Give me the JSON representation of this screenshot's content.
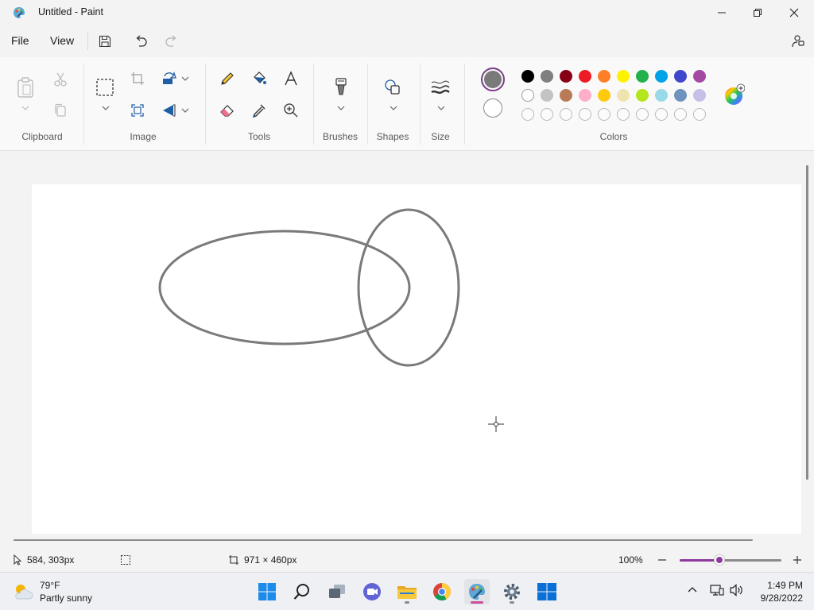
{
  "window": {
    "title": "Untitled - Paint",
    "app_icon": "paint-palette-icon",
    "controls": [
      "minimize-icon",
      "maximize-icon",
      "close-icon"
    ]
  },
  "menu": {
    "items": [
      "File",
      "View"
    ],
    "quick_access": [
      "save-icon",
      "undo-icon",
      "redo-icon"
    ],
    "share_icon": "share-icon"
  },
  "ribbon": {
    "groups": [
      {
        "label": "Clipboard",
        "tools": [
          "paste-icon",
          "cut-icon",
          "copy-icon"
        ]
      },
      {
        "label": "Image",
        "tools": [
          "select-icon",
          "crop-icon",
          "resize-icon",
          "image-search-icon",
          "rotate-icon",
          "flip-icon"
        ]
      },
      {
        "label": "Tools",
        "tools": [
          "pencil-icon",
          "fill-icon",
          "text-icon",
          "eraser-icon",
          "color-picker-icon",
          "magnifier-icon"
        ]
      },
      {
        "label": "Brushes",
        "tools": [
          "brush-icon"
        ]
      },
      {
        "label": "Shapes",
        "tools": [
          "shapes-icon"
        ]
      },
      {
        "label": "Size",
        "tools": [
          "size-icon"
        ]
      },
      {
        "label": "Colors",
        "tools": [
          "edit-colors-icon"
        ]
      }
    ],
    "primary_color": "#7a7a7a",
    "secondary_color": "#ffffff",
    "palette_row1": [
      "#000000",
      "#7f7f7f",
      "#880015",
      "#ed1c24",
      "#ff7f27",
      "#fff200",
      "#22b14c",
      "#00a2e8",
      "#3f48cc",
      "#a349a4"
    ],
    "palette_row2": [
      "#ffffff",
      "#c3c3c3",
      "#b97a57",
      "#ffaec9",
      "#ffc90e",
      "#efe4b0",
      "#b5e61d",
      "#99d9ea",
      "#7092be",
      "#c8bfe7"
    ],
    "palette_row3_empty_count": 10
  },
  "canvas": {
    "stroke_color": "#7a7a7a",
    "shapes": [
      "ellipse",
      "ellipse"
    ]
  },
  "status": {
    "cursor_position": "584, 303px",
    "selection_icon": "selection-size-icon",
    "canvas_size": "971 × 460px",
    "zoom": "100%",
    "zoom_level": 0.39
  },
  "taskbar": {
    "weather": {
      "temp": "79°F",
      "condition": "Partly sunny"
    },
    "apps": [
      "start-icon",
      "search-icon",
      "task-view-icon",
      "teams-chat-icon",
      "file-explorer-icon",
      "chrome-icon",
      "paint-icon",
      "settings-icon",
      "store-icon"
    ],
    "time": "1:49 PM",
    "date": "9/28/2022"
  }
}
